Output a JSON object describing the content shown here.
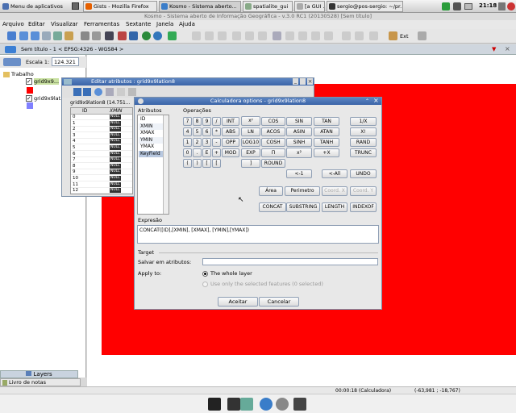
{
  "taskbar": {
    "apps_menu": "Menu de aplicativos",
    "tasks": [
      "Gists - Mozilla Firefox",
      "Kosmo - Sistema aberto...",
      "spatialite_gui",
      "[a GUI ...",
      "sergio@pos-sergio: ~/pr..."
    ],
    "clock": "21:18"
  },
  "window_title": "Kosmo - Sistema aberto de Informação Geográfica - v.3.0 RC1 (20130528) [Sem título]",
  "menu": [
    "Arquivo",
    "Editar",
    "Visualizar",
    "Ferramentas",
    "Sextante",
    "Janela",
    "Ajuda"
  ],
  "toolbar": {
    "ext_label": "Ext"
  },
  "doc_tab": {
    "title": "Sem título - 1 < EPSG:4326 - WGS84 >"
  },
  "left_panel": {
    "scale_label": "Escala 1:",
    "scale_value": "124.321",
    "root": "Trabalho",
    "layer1": "grid9x9...",
    "layer2": "grid9x9lat...",
    "tab_layers": "Layers",
    "tab_notes": "Livro de notas"
  },
  "edit_window": {
    "title": "Editar atributos : grid9x9lation8",
    "sub_title": "grid9x9lation8 (14.751...",
    "col_id": "ID",
    "col_xmin": "XMIN",
    "null_text": "NULL",
    "rows": [
      "0",
      "1",
      "2",
      "3",
      "4",
      "5",
      "6",
      "7",
      "8",
      "9",
      "10",
      "11",
      "12"
    ]
  },
  "calc_window": {
    "title": "Calculadora options - grid9x9lation8",
    "attrs_label": "Atributos",
    "attrs": [
      "ID",
      "XMIN",
      "XMAX",
      "YMIN",
      "YMAX",
      "KeyField"
    ],
    "ops_label": "Operações",
    "expr_label": "Expresão",
    "expr_value": "CONCAT([ID],[XMIN], [XMAX], [YMIN],[YMAX])",
    "target_label": "Target",
    "save_label": "Salvar em atributos:",
    "apply_label": "Apply to:",
    "radio_whole": "The whole layer",
    "radio_selected": "Use only the selected features (0 selected)",
    "ok_button": "Aceitar",
    "cancel_button": "Cancelar"
  },
  "statusbar": {
    "time": "00:00:18 (Calculadora)",
    "coords": "(-63,981 ; -18,767)"
  }
}
